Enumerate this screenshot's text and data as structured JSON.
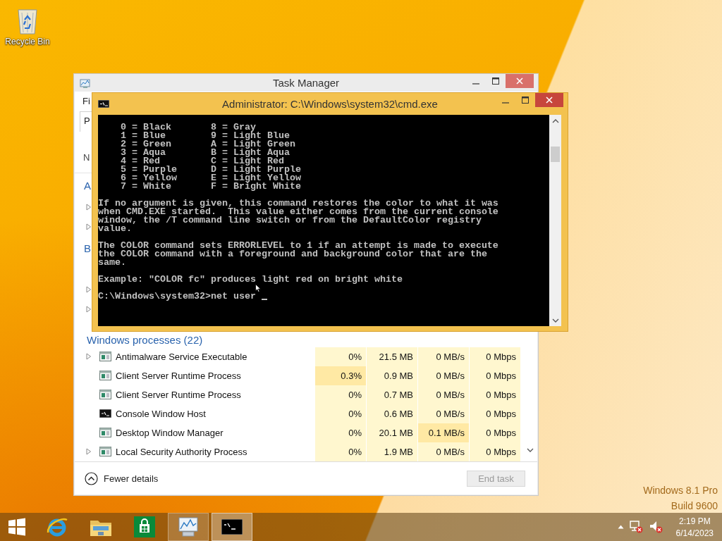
{
  "desktop": {
    "icons": [
      {
        "label": "Recycle Bin"
      }
    ],
    "watermark": [
      "Windows 8.1 Pro",
      "Build 9600"
    ]
  },
  "task_manager": {
    "title": "Task Manager",
    "menu": [
      "Fi"
    ],
    "tabs": [
      {
        "label": "P",
        "selected": true
      }
    ],
    "columns": [
      {
        "label": "N"
      }
    ],
    "list": [
      {
        "kind": "section",
        "text": "A"
      },
      {
        "kind": "row",
        "expandable": true
      },
      {
        "kind": "row",
        "expandable": true
      },
      {
        "kind": "section",
        "text": "B"
      },
      {
        "kind": "row",
        "expandable": false
      },
      {
        "kind": "row",
        "expandable": true
      },
      {
        "kind": "row",
        "expandable": true
      },
      {
        "kind": "group",
        "text": "Windows processes (22)"
      },
      {
        "kind": "process",
        "expandable": true,
        "name": "Antimalware Service Executable",
        "cells": [
          {
            "text": "0%",
            "hot": false
          },
          {
            "text": "21.5 MB",
            "hot": false
          },
          {
            "text": "0 MB/s",
            "hot": false
          },
          {
            "text": "0 Mbps",
            "hot": false
          }
        ]
      },
      {
        "kind": "process",
        "expandable": false,
        "name": "Client Server Runtime Process",
        "cells": [
          {
            "text": "0.3%",
            "hot": true
          },
          {
            "text": "0.9 MB",
            "hot": false
          },
          {
            "text": "0 MB/s",
            "hot": false
          },
          {
            "text": "0 Mbps",
            "hot": false
          }
        ]
      },
      {
        "kind": "process",
        "expandable": false,
        "name": "Client Server Runtime Process",
        "cells": [
          {
            "text": "0%",
            "hot": false
          },
          {
            "text": "0.7 MB",
            "hot": false
          },
          {
            "text": "0 MB/s",
            "hot": false
          },
          {
            "text": "0 Mbps",
            "hot": false
          }
        ]
      },
      {
        "kind": "console_process",
        "expandable": false,
        "name": "Console Window Host",
        "cells": [
          {
            "text": "0%",
            "hot": false
          },
          {
            "text": "0.6 MB",
            "hot": false
          },
          {
            "text": "0 MB/s",
            "hot": false
          },
          {
            "text": "0 Mbps",
            "hot": false
          }
        ]
      },
      {
        "kind": "process",
        "expandable": false,
        "name": "Desktop Window Manager",
        "cells": [
          {
            "text": "0%",
            "hot": false
          },
          {
            "text": "20.1 MB",
            "hot": false
          },
          {
            "text": "0.1 MB/s",
            "hot": true
          },
          {
            "text": "0 Mbps",
            "hot": false
          }
        ]
      },
      {
        "kind": "process",
        "expandable": true,
        "name": "Local Security Authority Process",
        "cells": [
          {
            "text": "0%",
            "hot": false
          },
          {
            "text": "1.9 MB",
            "hot": false
          },
          {
            "text": "0 MB/s",
            "hot": false
          },
          {
            "text": "0 Mbps",
            "hot": false
          }
        ]
      }
    ],
    "footer": {
      "toggle": "Fewer details",
      "end_task": {
        "label": "End task",
        "disabled": true
      }
    }
  },
  "console": {
    "title": "Administrator: C:\\Windows\\system32\\cmd.exe",
    "cursor": true,
    "blocks": [
      [
        "    0 = Black       8 = Gray",
        "    1 = Blue        9 = Light Blue",
        "    2 = Green       A = Light Green",
        "    3 = Aqua        B = Light Aqua",
        "    4 = Red         C = Light Red",
        "    5 = Purple      D = Light Purple",
        "    6 = Yellow      E = Light Yellow",
        "    7 = White       F = Bright White"
      ],
      [
        "If no argument is given, this command restores the color to what it was",
        "when CMD.EXE started.  This value either comes from the current console",
        "window, the /T command line switch or from the DefaultColor registry",
        "value."
      ],
      [
        "The COLOR command sets ERRORLEVEL to 1 if an attempt is made to execute",
        "the COLOR command with a foreground and background color that are the",
        "same."
      ],
      [
        "Example: \"COLOR fc\" produces light red on bright white"
      ],
      [
        "C:\\Windows\\system32>net user "
      ]
    ]
  },
  "taskbar": {
    "items": [
      {
        "kind": "start"
      },
      {
        "kind": "browser",
        "running": false,
        "selected": false
      },
      {
        "kind": "folder",
        "running": false,
        "selected": false
      },
      {
        "kind": "store",
        "running": false,
        "selected": false
      },
      {
        "kind": "taskmgr",
        "running": true,
        "selected": false
      },
      {
        "kind": "console",
        "running": true,
        "selected": true
      }
    ],
    "tray": [
      {
        "kind": "caret"
      },
      {
        "kind": "network_error"
      },
      {
        "kind": "volume_muted"
      }
    ],
    "clock": {
      "time": "2:19 PM",
      "date": "6/14/2023"
    }
  }
}
